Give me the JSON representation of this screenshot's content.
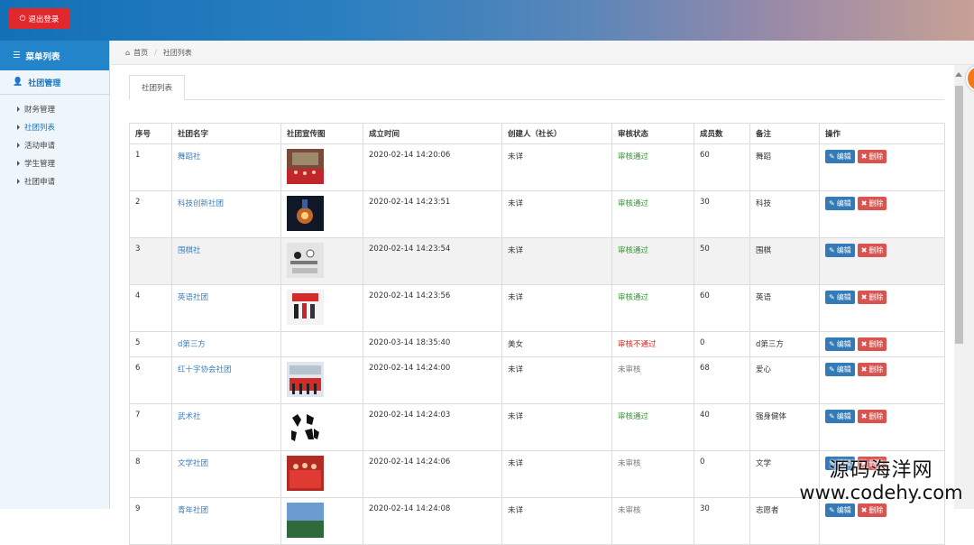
{
  "header": {
    "logout_label": "退出登录"
  },
  "sidebar": {
    "menu_title": "菜单列表",
    "group_title": "社团管理",
    "items": [
      {
        "label": "财务管理",
        "active": false
      },
      {
        "label": "社团列表",
        "active": true
      },
      {
        "label": "活动申请",
        "active": false
      },
      {
        "label": "学生管理",
        "active": false
      },
      {
        "label": "社团申请",
        "active": false
      }
    ]
  },
  "breadcrumb": {
    "home": "首页",
    "current": "社团列表"
  },
  "tab": {
    "label": "社团列表"
  },
  "table": {
    "columns": [
      "序号",
      "社团名字",
      "社团宣传图",
      "成立时间",
      "创建人（社长）",
      "审核状态",
      "成员数",
      "备注",
      "操作"
    ],
    "edit_label": "编辑",
    "delete_label": "删除",
    "rows": [
      {
        "id": "1",
        "name": "舞蹈社",
        "image": "dance",
        "founded": "2020-02-14 14:20:06",
        "creator": "未详",
        "status": "审核通过",
        "status_type": "ok",
        "members": "60",
        "note": "舞蹈"
      },
      {
        "id": "2",
        "name": "科技创新社团",
        "image": "tech",
        "founded": "2020-02-14 14:23:51",
        "creator": "未详",
        "status": "审核通过",
        "status_type": "ok",
        "members": "30",
        "note": "科技"
      },
      {
        "id": "3",
        "name": "围棋社",
        "image": "go",
        "founded": "2020-02-14 14:23:54",
        "creator": "未详",
        "status": "审核通过",
        "status_type": "ok",
        "members": "50",
        "note": "围棋"
      },
      {
        "id": "4",
        "name": "英语社团",
        "image": "english",
        "founded": "2020-02-14 14:23:56",
        "creator": "未详",
        "status": "审核通过",
        "status_type": "ok",
        "members": "60",
        "note": "英语"
      },
      {
        "id": "5",
        "name": "d第三方",
        "image": "",
        "founded": "2020-03-14 18:35:40",
        "creator": "美女",
        "status": "审核不通过",
        "status_type": "bad",
        "members": "0",
        "note": "d第三方"
      },
      {
        "id": "6",
        "name": "红十字协会社团",
        "image": "redcross",
        "founded": "2020-02-14 14:24:00",
        "creator": "未详",
        "status": "未审核",
        "status_type": "pend",
        "members": "68",
        "note": "爱心"
      },
      {
        "id": "7",
        "name": "武术社",
        "image": "wushu",
        "founded": "2020-02-14 14:24:03",
        "creator": "未详",
        "status": "审核通过",
        "status_type": "ok",
        "members": "40",
        "note": "强身健体"
      },
      {
        "id": "8",
        "name": "文学社团",
        "image": "literature",
        "founded": "2020-02-14 14:24:06",
        "creator": "未详",
        "status": "未审核",
        "status_type": "pend",
        "members": "0",
        "note": "文学"
      },
      {
        "id": "9",
        "name": "青年社团",
        "image": "youth",
        "founded": "2020-02-14 14:24:08",
        "creator": "未详",
        "status": "未审核",
        "status_type": "pend",
        "members": "30",
        "note": "志愿者"
      }
    ]
  },
  "watermark": {
    "line1": "源码海洋网",
    "line2": "www.codehy.com"
  },
  "colors": {
    "accent": "#2384c9",
    "danger": "#d9534f",
    "primary": "#337ab7",
    "ok": "#2d9a2d",
    "bad": "#e02020"
  }
}
